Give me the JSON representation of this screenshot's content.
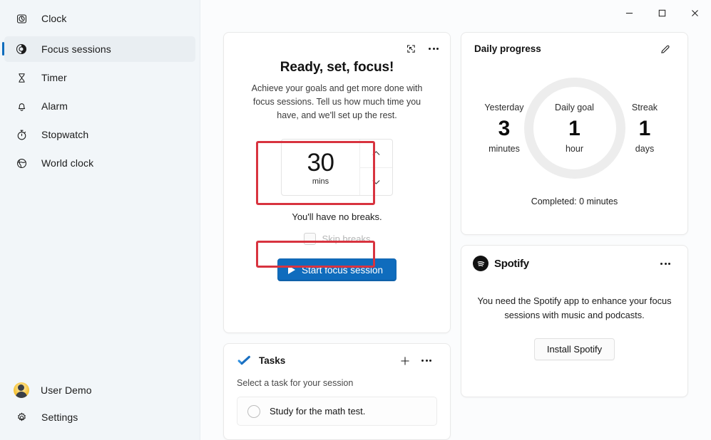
{
  "window": {
    "app_title": "Clock",
    "controls": {
      "minimize": "minimize-icon",
      "maximize": "maximize-icon",
      "close": "close-icon"
    }
  },
  "sidebar": {
    "header": {
      "label": "Clock",
      "icon": "clock-icon"
    },
    "items": [
      {
        "label": "Focus sessions",
        "icon": "focus-sessions-icon",
        "selected": true
      },
      {
        "label": "Timer",
        "icon": "hourglass-icon",
        "selected": false
      },
      {
        "label": "Alarm",
        "icon": "bell-icon",
        "selected": false
      },
      {
        "label": "Stopwatch",
        "icon": "stopwatch-icon",
        "selected": false
      },
      {
        "label": "World clock",
        "icon": "globe-icon",
        "selected": false
      }
    ],
    "bottom": [
      {
        "label": "User Demo",
        "icon": "avatar"
      },
      {
        "label": "Settings",
        "icon": "gear-icon"
      }
    ]
  },
  "focus_card": {
    "title": "Ready, set, focus!",
    "description": "Achieve your goals and get more done with focus sessions. Tell us how much time you have, and we'll set up the rest.",
    "spinner": {
      "value": "30",
      "unit": "mins",
      "up_icon": "chevron-up-icon",
      "down_icon": "chevron-down-icon"
    },
    "breaks_text": "You'll have no breaks.",
    "skip_breaks_label": "Skip breaks",
    "skip_breaks_checked": false,
    "start_button": "Start focus session",
    "tools": {
      "mini_view": "mini-view-icon",
      "more": "more-options-icon"
    },
    "accent_color": "#0f6cbd"
  },
  "tasks_card": {
    "title": "Tasks",
    "logo": "microsoft-todo-icon",
    "add_icon": "plus-icon",
    "more_icon": "more-options-icon",
    "subtitle": "Select a task for your session",
    "items": [
      {
        "text": "Study for the math test.",
        "done": false
      }
    ]
  },
  "progress_card": {
    "title": "Daily progress",
    "edit_icon": "pencil-icon",
    "yesterday": {
      "label": "Yesterday",
      "value": "3",
      "unit": "minutes"
    },
    "daily_goal": {
      "label": "Daily goal",
      "value": "1",
      "unit": "hour"
    },
    "streak": {
      "label": "Streak",
      "value": "1",
      "unit": "days"
    },
    "completed": "Completed: 0 minutes",
    "ring_color": "#ededed"
  },
  "spotify_card": {
    "name": "Spotify",
    "logo": "spotify-icon",
    "more_icon": "more-options-icon",
    "message": "You need the Spotify app to enhance your focus sessions with music and podcasts.",
    "install_button": "Install Spotify"
  },
  "annotations": {
    "color": "#d8333f",
    "boxes": [
      {
        "name": "timer-spinner-highlight"
      },
      {
        "name": "start-button-highlight"
      }
    ]
  }
}
